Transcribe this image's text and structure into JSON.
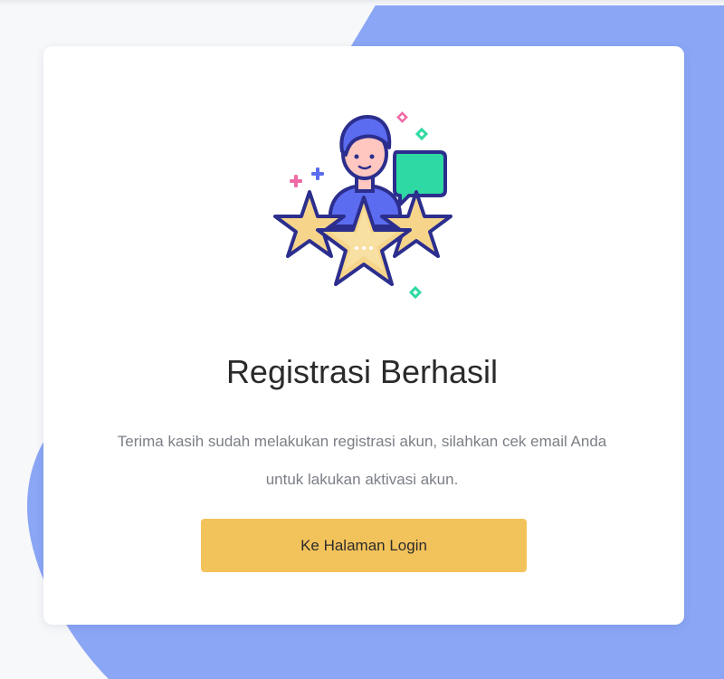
{
  "success": {
    "title": "Registrasi Berhasil",
    "message": "Terima kasih sudah melakukan registrasi akun, silahkan cek email Anda untuk lakukan aktivasi akun.",
    "button_label": "Ke Halaman Login"
  },
  "illustration": {
    "icon": "rating-stars-person-icon",
    "colors": {
      "star_fill": "#f6d58b",
      "outline": "#2c2e8e",
      "accent_blue": "#5b6cf0",
      "accent_green": "#2fd9a3",
      "accent_pink": "#f06aa6",
      "skin": "#ffc7bf"
    }
  },
  "theme": {
    "background_shape": "#8aa6f5",
    "button": "#f3c35b",
    "card": "#ffffff"
  }
}
